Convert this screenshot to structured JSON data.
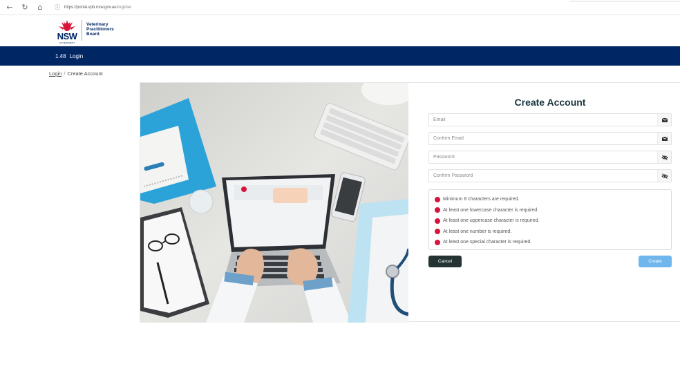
{
  "browser": {
    "url_host": "https://portal.vpb.nsw.gov.au",
    "url_path": "/register",
    "back_icon": "back-arrow-icon",
    "refresh_icon": "refresh-icon",
    "home_icon": "home-icon"
  },
  "header": {
    "nsw_wordmark": "NSW",
    "gov_label": "GOVERNMENT",
    "board_line1": "Veterinary",
    "board_line2": "Practitioners",
    "board_line3": "Board"
  },
  "navbar": {
    "version": "1.48",
    "login_label": "Login"
  },
  "breadcrumb": {
    "parent": "Login",
    "separator": "/",
    "current": "Create Account"
  },
  "form": {
    "title": "Create Account",
    "email": {
      "placeholder": "Email",
      "value": "",
      "icon": "envelope-icon"
    },
    "confirm_email": {
      "placeholder": "Confirm Email",
      "value": "",
      "icon": "envelope-icon"
    },
    "password": {
      "placeholder": "Password",
      "value": "",
      "icon": "eye-slash-icon"
    },
    "confirm_password": {
      "placeholder": "Confirm Password",
      "value": "",
      "icon": "eye-slash-icon"
    },
    "rules": [
      {
        "text": "Minimum 8 characters are required.",
        "status": "error"
      },
      {
        "text": "At least one lowercase character is required.",
        "status": "error"
      },
      {
        "text": "At least one uppercase character is required.",
        "status": "error"
      },
      {
        "text": "At least one number is required.",
        "status": "error"
      },
      {
        "text": "At least one special character is required.",
        "status": "error"
      }
    ],
    "cancel_label": "Cancel",
    "create_label": "Create"
  },
  "colors": {
    "brand_navy": "#002664",
    "nsw_red": "#d7153a",
    "cancel_bg": "#253333",
    "create_bg": "#6fb6ec",
    "title_color": "#17333b"
  }
}
